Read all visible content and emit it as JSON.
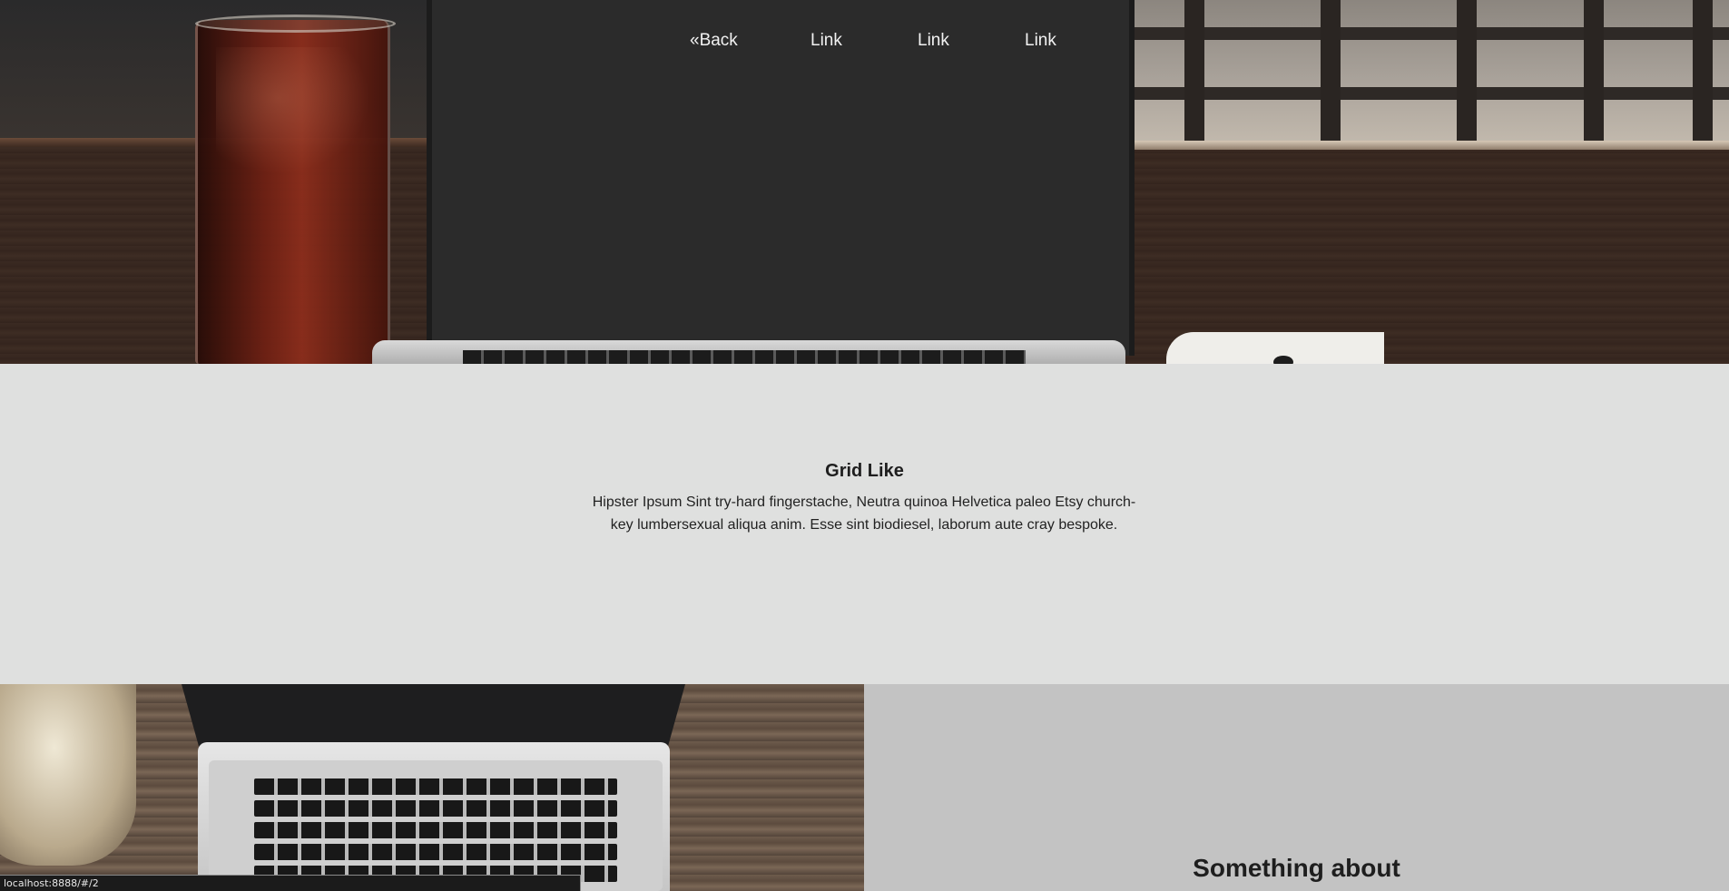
{
  "nav": {
    "back_label": "«Back",
    "links": [
      "Link",
      "Link",
      "Link"
    ]
  },
  "intro": {
    "title": "Grid Like",
    "text": "Hipster Ipsum Sint try-hard fingerstache, Neutra quinoa Helvetica paleo Etsy church-key lumbersexual aliqua anim. Esse sint biodiesel, laborum aute cray bespoke."
  },
  "tile": {
    "title": "Something about"
  },
  "status_bar": {
    "url": "localhost:8888/#/2"
  },
  "colors": {
    "intro_bg": "#dfe0df",
    "tile_bg": "#c3c3c3",
    "nav_text": "#f2f2f2"
  }
}
